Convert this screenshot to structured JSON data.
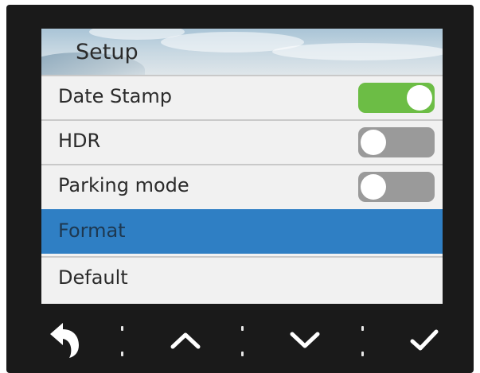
{
  "screen": {
    "title": "Setup",
    "items": [
      {
        "label": "Date Stamp",
        "toggle": "on"
      },
      {
        "label": "HDR",
        "toggle": "off"
      },
      {
        "label": "Parking mode",
        "toggle": "off"
      },
      {
        "label": "Format",
        "selected": true
      },
      {
        "label": "Default"
      }
    ]
  },
  "colors": {
    "toggle_on": "#6cbd45",
    "toggle_off": "#9a9a9a",
    "selected_row": "#2f7fc4"
  },
  "buttons": [
    {
      "icon": "back-arrow-icon"
    },
    {
      "icon": "chevron-up-icon"
    },
    {
      "icon": "chevron-down-icon"
    },
    {
      "icon": "checkmark-icon"
    }
  ]
}
